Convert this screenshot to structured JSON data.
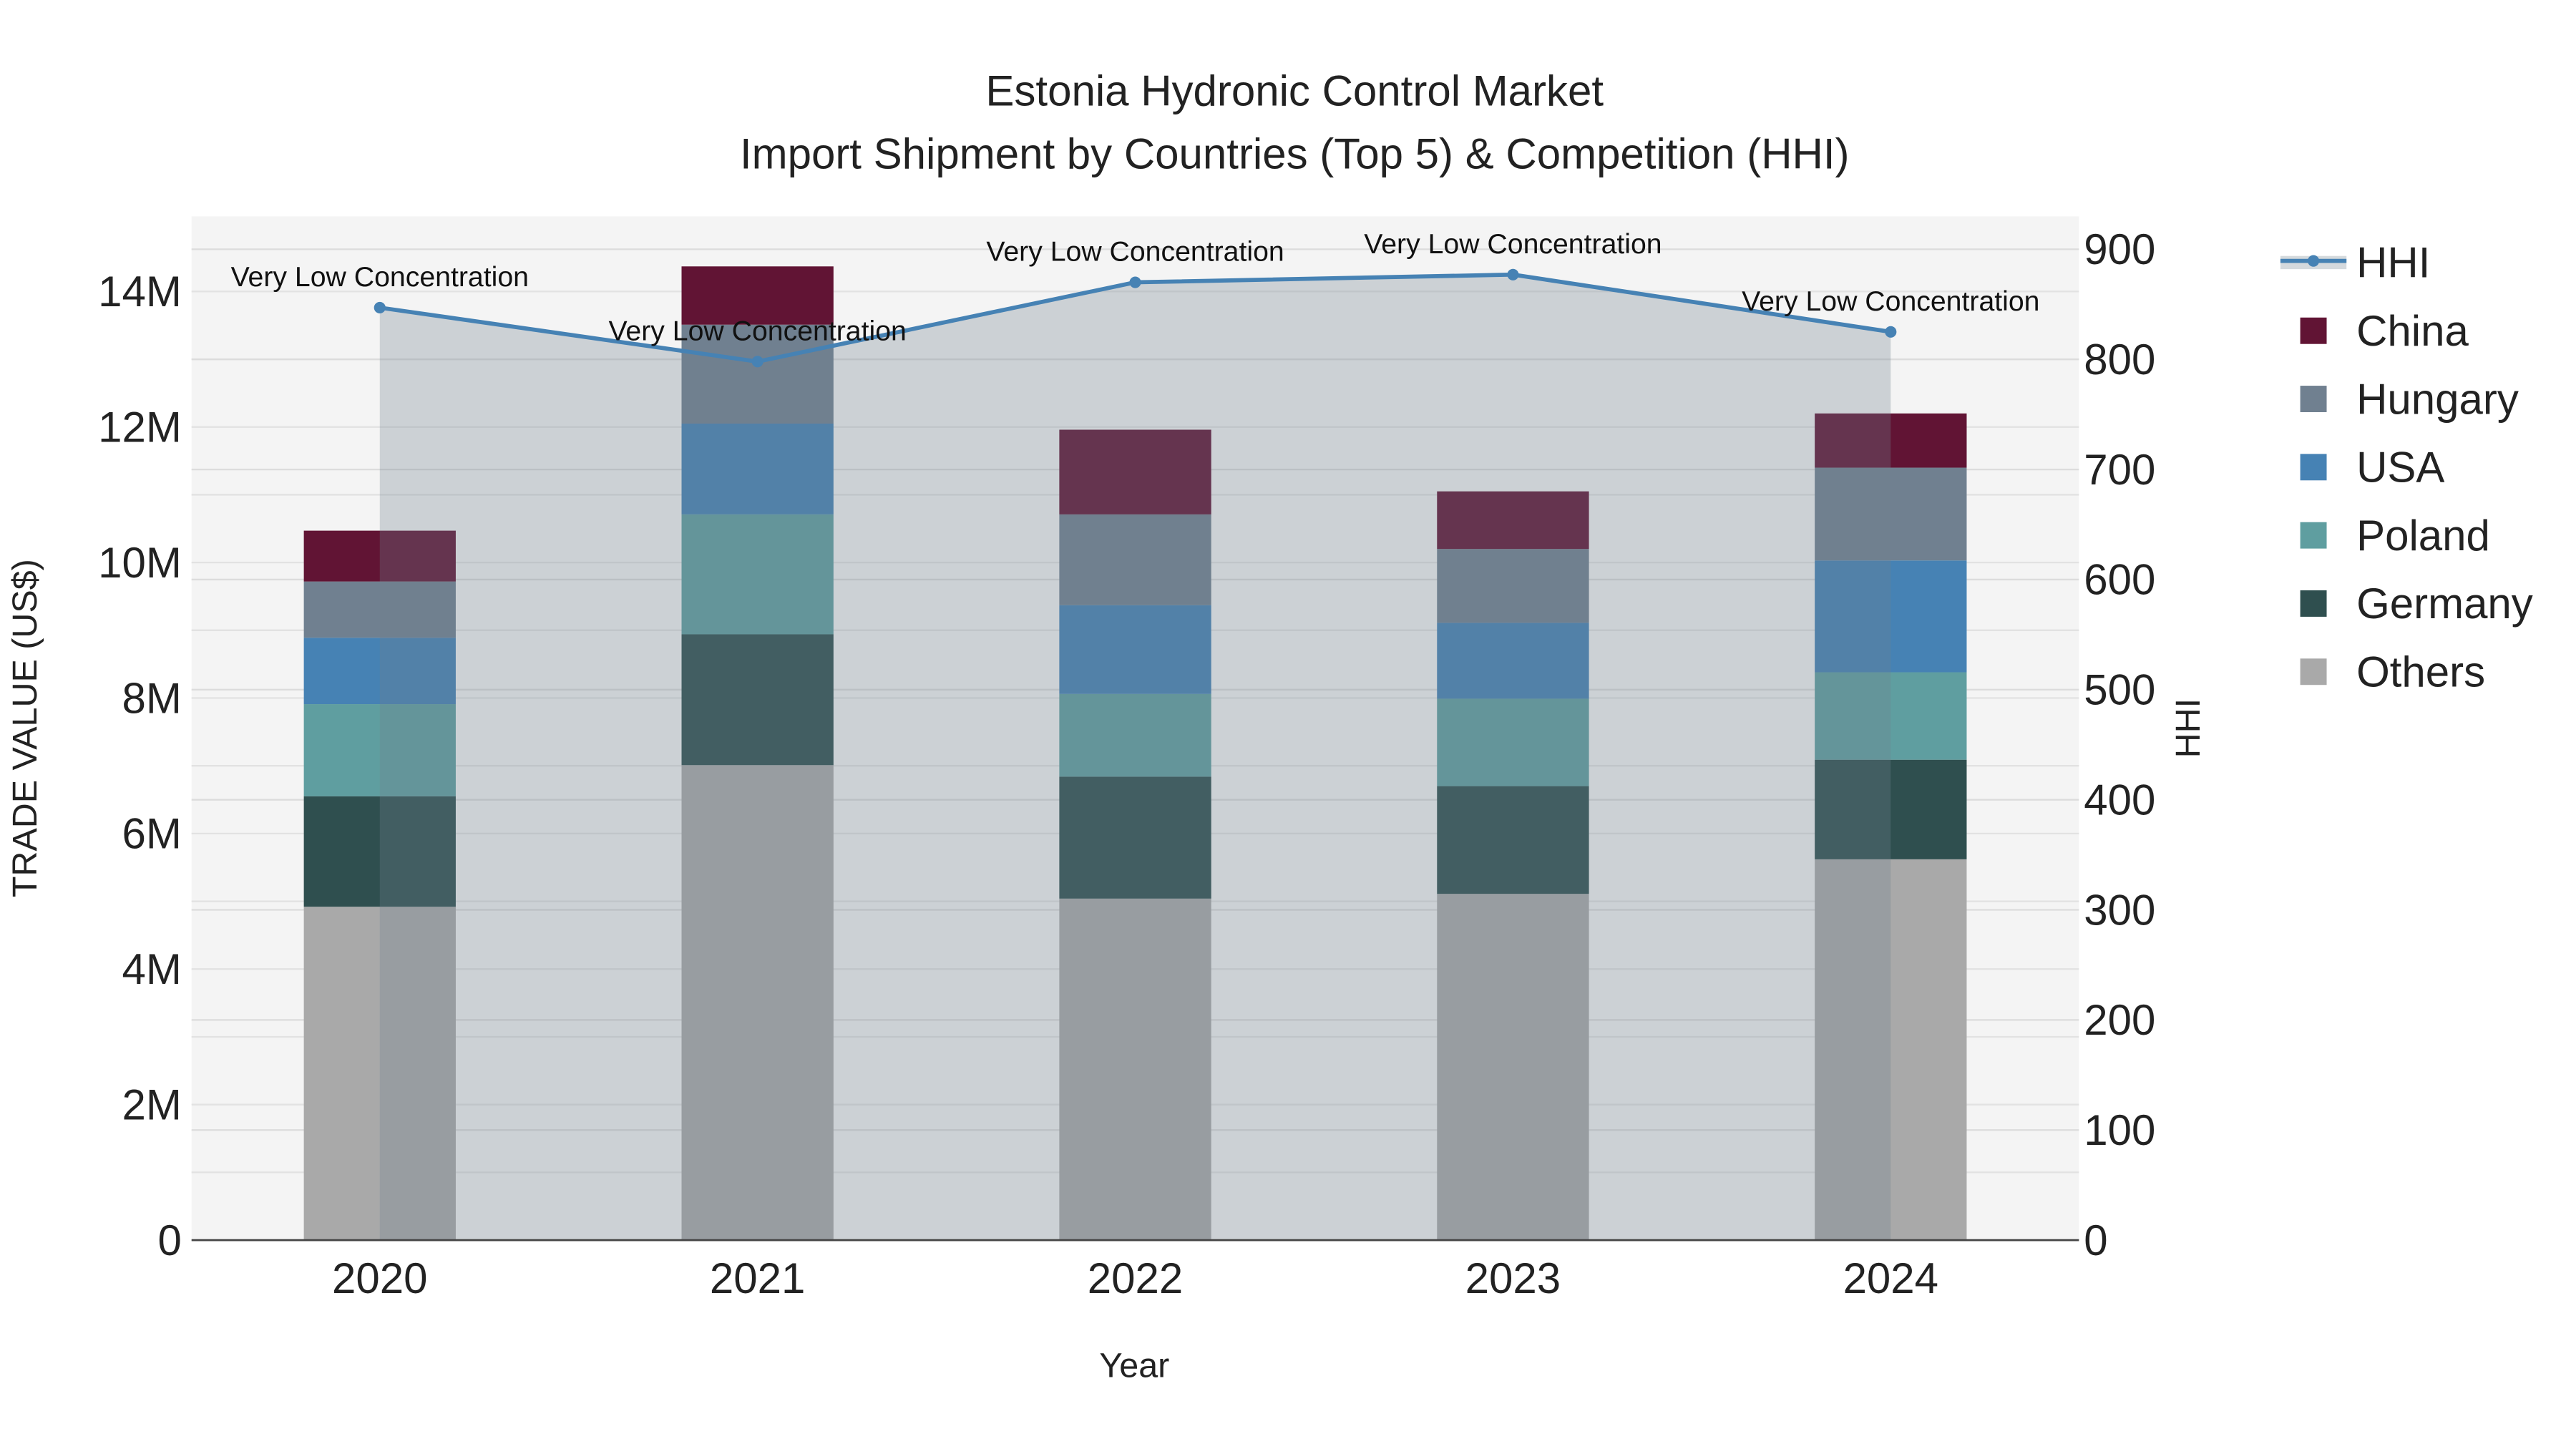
{
  "chart_data": {
    "type": "bar",
    "title": "Estonia Hydronic Control Market",
    "subtitle": "Import Shipment by Countries (Top 5) & Competition (HHI)",
    "xlabel": "Year",
    "ylabel": "TRADE VALUE (US$)",
    "y2label": "HHI",
    "categories": [
      "2020",
      "2021",
      "2022",
      "2023",
      "2024"
    ],
    "stacked": true,
    "ylim": [
      0,
      15100000
    ],
    "y2lim": [
      0,
      930
    ],
    "yticks": [
      0,
      2000000,
      4000000,
      6000000,
      8000000,
      10000000,
      12000000,
      14000000
    ],
    "ytick_labels": [
      "0",
      "2M",
      "4M",
      "6M",
      "8M",
      "10M",
      "12M",
      "14M"
    ],
    "y2ticks": [
      0,
      100,
      200,
      300,
      400,
      500,
      600,
      700,
      800,
      900
    ],
    "y2tick_labels": [
      "0",
      "100",
      "200",
      "300",
      "400",
      "500",
      "600",
      "700",
      "800",
      "900"
    ],
    "series": [
      {
        "name": "Others",
        "color": "#a9a9a9",
        "values": [
          4920000,
          7010000,
          5040000,
          5110000,
          5620000
        ]
      },
      {
        "name": "Germany",
        "color": "#2f4f4f",
        "values": [
          1630000,
          1930000,
          1800000,
          1590000,
          1470000
        ]
      },
      {
        "name": "Poland",
        "color": "#5f9ea0",
        "values": [
          1360000,
          1770000,
          1220000,
          1290000,
          1290000
        ]
      },
      {
        "name": "USA",
        "color": "#4682b4",
        "values": [
          980000,
          1340000,
          1310000,
          1120000,
          1650000
        ]
      },
      {
        "name": "Hungary",
        "color": "#708090",
        "values": [
          830000,
          1460000,
          1340000,
          1090000,
          1370000
        ]
      },
      {
        "name": "China",
        "color": "#611434",
        "values": [
          750000,
          860000,
          1250000,
          850000,
          800000
        ]
      }
    ],
    "hhi": {
      "name": "HHI",
      "color": "#4682b4",
      "values": [
        847,
        798,
        870,
        877,
        825
      ],
      "annotations": [
        "Very Low Concentration",
        "Very Low Concentration",
        "Very Low Concentration",
        "Very Low Concentration",
        "Very Low Concentration"
      ]
    },
    "legend": {
      "position": "right",
      "order": [
        "HHI",
        "China",
        "Hungary",
        "USA",
        "Poland",
        "Germany",
        "Others"
      ]
    },
    "grid": true
  }
}
